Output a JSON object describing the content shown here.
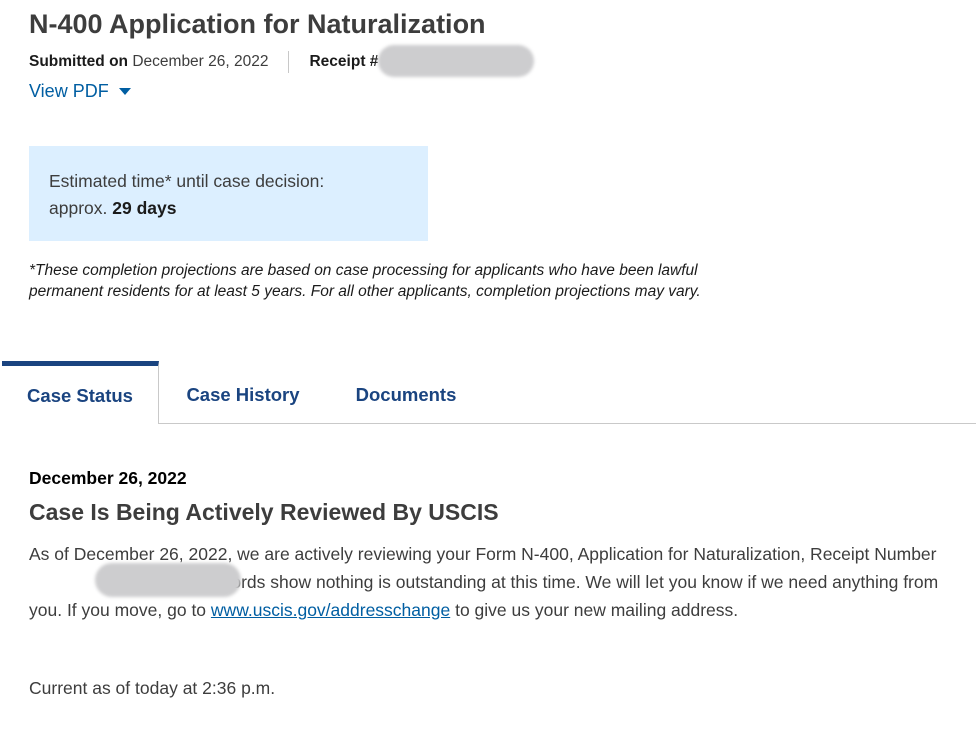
{
  "header": {
    "title": "N-400 Application for Naturalization",
    "submitted_label": "Submitted on",
    "submitted_date": "December 26, 2022",
    "receipt_label": "Receipt #",
    "view_pdf_label": "View PDF"
  },
  "estimate": {
    "line1": "Estimated time* until case decision:",
    "approx_prefix": "approx.",
    "days": "29 days"
  },
  "footnote": "*These completion projections are based on case processing for applicants who have been lawful permanent residents for at least 5 years. For all other applicants, completion projections may vary.",
  "tabs": [
    {
      "label": "Case Status",
      "active": true
    },
    {
      "label": "Case History",
      "active": false
    },
    {
      "label": "Documents",
      "active": false
    }
  ],
  "status": {
    "date": "December 26, 2022",
    "title": "Case Is Being Actively Reviewed By USCIS",
    "body_part1": "As of December 26, 2022, we are actively reviewing your Form N-400, Application for Naturalization, Receipt Number",
    "body_part2": "Our records show nothing is outstanding at this time. We will let you know if we need anything from you. If you move, go to",
    "link_text": "www.uscis.gov/addresschange",
    "body_part3": "to give us your new mailing address.",
    "current_as_of": "Current as of today at 2:36 p.m."
  },
  "colors": {
    "link": "#005ea2",
    "tab_text": "#1a4480",
    "estimate_bg": "#dcefff"
  }
}
